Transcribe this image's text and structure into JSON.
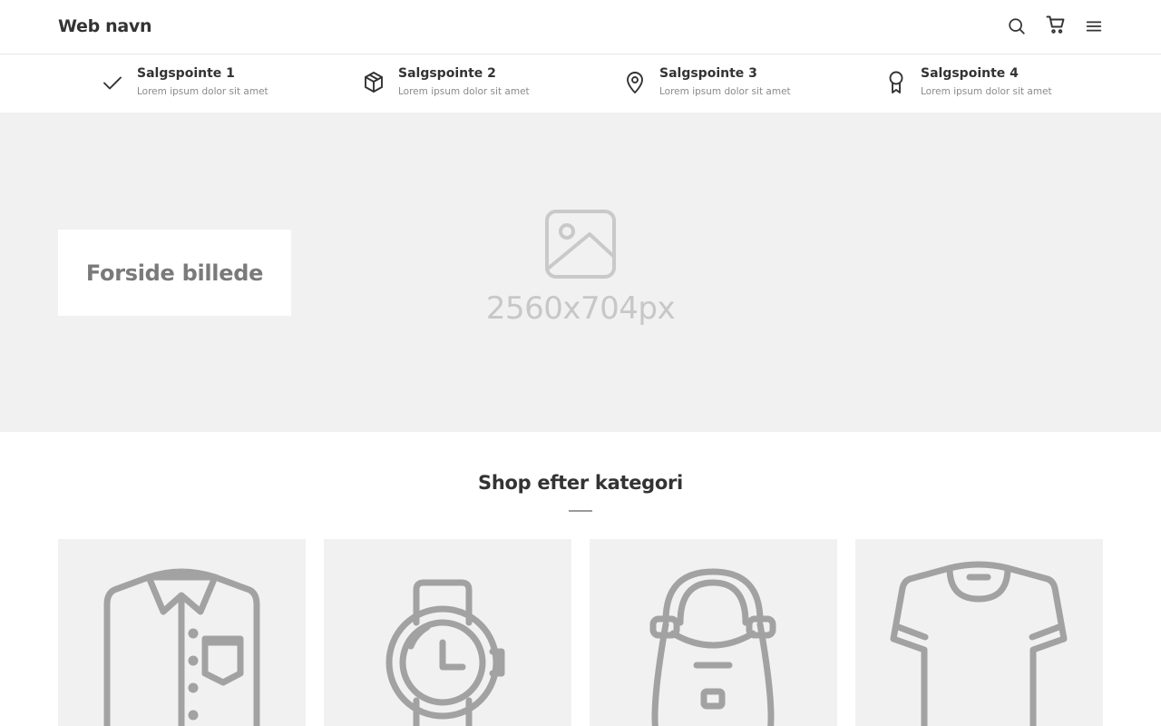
{
  "header": {
    "brand": "Web navn",
    "icons": [
      "search-icon",
      "cart-icon",
      "menu-icon"
    ]
  },
  "usps": [
    {
      "icon": "checkmark-icon",
      "title": "Salgspointe 1",
      "subtitle": "Lorem ipsum dolor sit amet"
    },
    {
      "icon": "box-icon",
      "title": "Salgspointe 2",
      "subtitle": "Lorem ipsum dolor sit amet"
    },
    {
      "icon": "location-pin-icon",
      "title": "Salgspointe 3",
      "subtitle": "Lorem ipsum dolor sit amet"
    },
    {
      "icon": "award-icon",
      "title": "Salgspointe 4",
      "subtitle": "Lorem ipsum dolor sit amet"
    }
  ],
  "hero": {
    "title": "Forside billede",
    "placeholder_text": "2560x704px",
    "placeholder_icon": "image-placeholder-icon"
  },
  "categories_section": {
    "title": "Shop efter kategori",
    "items": [
      {
        "icon": "shirt-icon"
      },
      {
        "icon": "watch-icon"
      },
      {
        "icon": "handbag-icon"
      },
      {
        "icon": "tshirt-icon"
      }
    ]
  },
  "colors": {
    "text": "#333333",
    "muted": "#8a8a8a",
    "hero_bg": "#f1f1f1",
    "icon_gray": "#a2a2a2"
  }
}
